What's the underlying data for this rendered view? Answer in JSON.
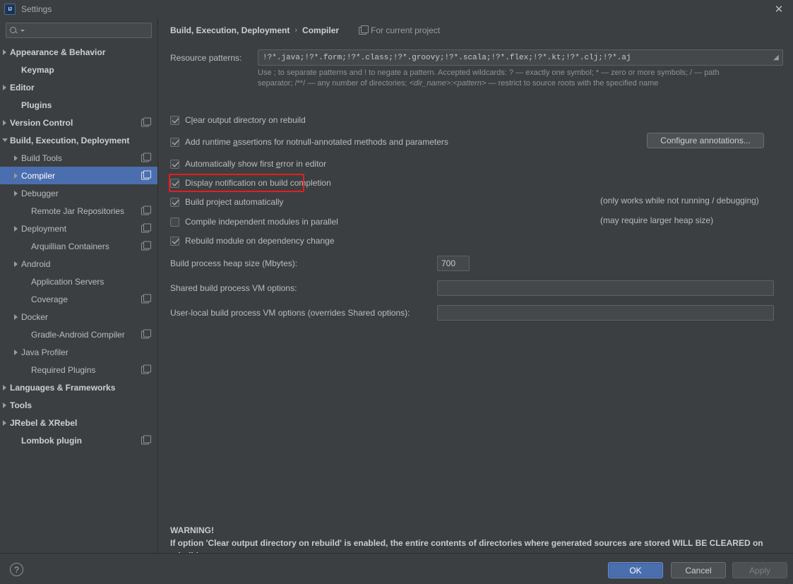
{
  "window": {
    "title": "Settings",
    "logo_icon": "intellij-idea-logo",
    "close_icon": "close-icon"
  },
  "sidebar": {
    "search": {
      "placeholder": "",
      "value": "",
      "icon": "search-icon",
      "caret_icon": "chevron-down-icon"
    },
    "items": [
      {
        "label": "Appearance & Behavior",
        "indent": 0,
        "twisty": "closed",
        "bold": true,
        "project_icon": false,
        "selected": false
      },
      {
        "label": "Keymap",
        "indent": 1,
        "twisty": "none",
        "bold": true,
        "project_icon": false,
        "selected": false
      },
      {
        "label": "Editor",
        "indent": 0,
        "twisty": "closed",
        "bold": true,
        "project_icon": false,
        "selected": false
      },
      {
        "label": "Plugins",
        "indent": 1,
        "twisty": "none",
        "bold": true,
        "project_icon": false,
        "selected": false
      },
      {
        "label": "Version Control",
        "indent": 0,
        "twisty": "closed",
        "bold": true,
        "project_icon": true,
        "selected": false
      },
      {
        "label": "Build, Execution, Deployment",
        "indent": 0,
        "twisty": "open",
        "bold": true,
        "project_icon": false,
        "selected": false
      },
      {
        "label": "Build Tools",
        "indent": 1,
        "twisty": "closed",
        "bold": false,
        "project_icon": true,
        "selected": false
      },
      {
        "label": "Compiler",
        "indent": 1,
        "twisty": "closed",
        "bold": false,
        "project_icon": true,
        "selected": true
      },
      {
        "label": "Debugger",
        "indent": 1,
        "twisty": "closed",
        "bold": false,
        "project_icon": false,
        "selected": false
      },
      {
        "label": "Remote Jar Repositories",
        "indent": 2,
        "twisty": "none",
        "bold": false,
        "project_icon": true,
        "selected": false
      },
      {
        "label": "Deployment",
        "indent": 1,
        "twisty": "closed",
        "bold": false,
        "project_icon": true,
        "selected": false
      },
      {
        "label": "Arquillian Containers",
        "indent": 2,
        "twisty": "none",
        "bold": false,
        "project_icon": true,
        "selected": false
      },
      {
        "label": "Android",
        "indent": 1,
        "twisty": "closed",
        "bold": false,
        "project_icon": false,
        "selected": false
      },
      {
        "label": "Application Servers",
        "indent": 2,
        "twisty": "none",
        "bold": false,
        "project_icon": false,
        "selected": false
      },
      {
        "label": "Coverage",
        "indent": 2,
        "twisty": "none",
        "bold": false,
        "project_icon": true,
        "selected": false
      },
      {
        "label": "Docker",
        "indent": 1,
        "twisty": "closed",
        "bold": false,
        "project_icon": false,
        "selected": false
      },
      {
        "label": "Gradle-Android Compiler",
        "indent": 2,
        "twisty": "none",
        "bold": false,
        "project_icon": true,
        "selected": false
      },
      {
        "label": "Java Profiler",
        "indent": 1,
        "twisty": "closed",
        "bold": false,
        "project_icon": false,
        "selected": false
      },
      {
        "label": "Required Plugins",
        "indent": 2,
        "twisty": "none",
        "bold": false,
        "project_icon": true,
        "selected": false
      },
      {
        "label": "Languages & Frameworks",
        "indent": 0,
        "twisty": "closed",
        "bold": true,
        "project_icon": false,
        "selected": false
      },
      {
        "label": "Tools",
        "indent": 0,
        "twisty": "closed",
        "bold": true,
        "project_icon": false,
        "selected": false
      },
      {
        "label": "JRebel & XRebel",
        "indent": 0,
        "twisty": "closed",
        "bold": true,
        "project_icon": false,
        "selected": false
      },
      {
        "label": "Lombok plugin",
        "indent": 1,
        "twisty": "none",
        "bold": true,
        "project_icon": true,
        "selected": false
      }
    ]
  },
  "main": {
    "breadcrumb": {
      "root": "Build, Execution, Deployment",
      "separator": "›",
      "leaf": "Compiler"
    },
    "scope_note": {
      "icon": "project-scope-icon",
      "label": "For current project"
    },
    "resource_patterns": {
      "label": "Resource patterns:",
      "value": "!?*.java;!?*.form;!?*.class;!?*.groovy;!?*.scala;!?*.flex;!?*.kt;!?*.clj;!?*.aj",
      "placeholder": "",
      "expand_icon": "expand-editor-icon"
    },
    "resource_patterns_help_line1": "Use ; to separate patterns and ! to negate a pattern. Accepted wildcards: ? — exactly one symbol; * — zero or more symbols; / — path",
    "resource_patterns_help_line2_a": "separator; /**/ — any number of directories;  ",
    "resource_patterns_help_line2_italic": "<dir_name>:<pattern>",
    "resource_patterns_help_line2_b": " — restrict to source roots with the specified name",
    "checkboxes": [
      {
        "label": "Clear output directory on rebuild",
        "checked": true,
        "mnemonic": "l",
        "note": ""
      },
      {
        "label": "Add runtime assertions for notnull-annotated methods and parameters",
        "checked": true,
        "mnemonic": "a",
        "note": ""
      },
      {
        "label": "Automatically show first error in editor",
        "checked": true,
        "mnemonic": "e",
        "note": ""
      },
      {
        "label": "Display notification on build completion",
        "checked": true,
        "mnemonic": "",
        "note": ""
      },
      {
        "label": "Build project automatically",
        "checked": true,
        "mnemonic": "",
        "note": "(only works while not running / debugging)"
      },
      {
        "label": "Compile independent modules in parallel",
        "checked": false,
        "mnemonic": "",
        "note": "(may require larger heap size)"
      },
      {
        "label": "Rebuild module on dependency change",
        "checked": true,
        "mnemonic": "",
        "note": ""
      }
    ],
    "configure_annotations_button": "Configure annotations...",
    "fields": [
      {
        "label": "Build process heap size (Mbytes):",
        "value": "700",
        "placeholder": ""
      },
      {
        "label": "Shared build process VM options:",
        "value": "",
        "placeholder": ""
      },
      {
        "label": "User-local build process VM options (overrides Shared options):",
        "value": "",
        "placeholder": ""
      }
    ],
    "warning": {
      "title": "WARNING!",
      "body": "If option 'Clear output directory on rebuild' is enabled, the entire contents of directories where generated sources are stored WILL BE CLEARED on rebuild."
    },
    "highlight_color": "#e02020",
    "highlight_target": "Build project automatically"
  },
  "footer": {
    "help_icon": "help-question-icon",
    "ok_label": "OK",
    "cancel_label": "Cancel",
    "apply_label": "Apply"
  },
  "colors": {
    "background": "#3c3f41",
    "selection": "#4b6eaf",
    "accent": "#4b6eaf",
    "field_background": "#45484a",
    "text": "#bbbbbb",
    "highlight": "#e02020"
  }
}
